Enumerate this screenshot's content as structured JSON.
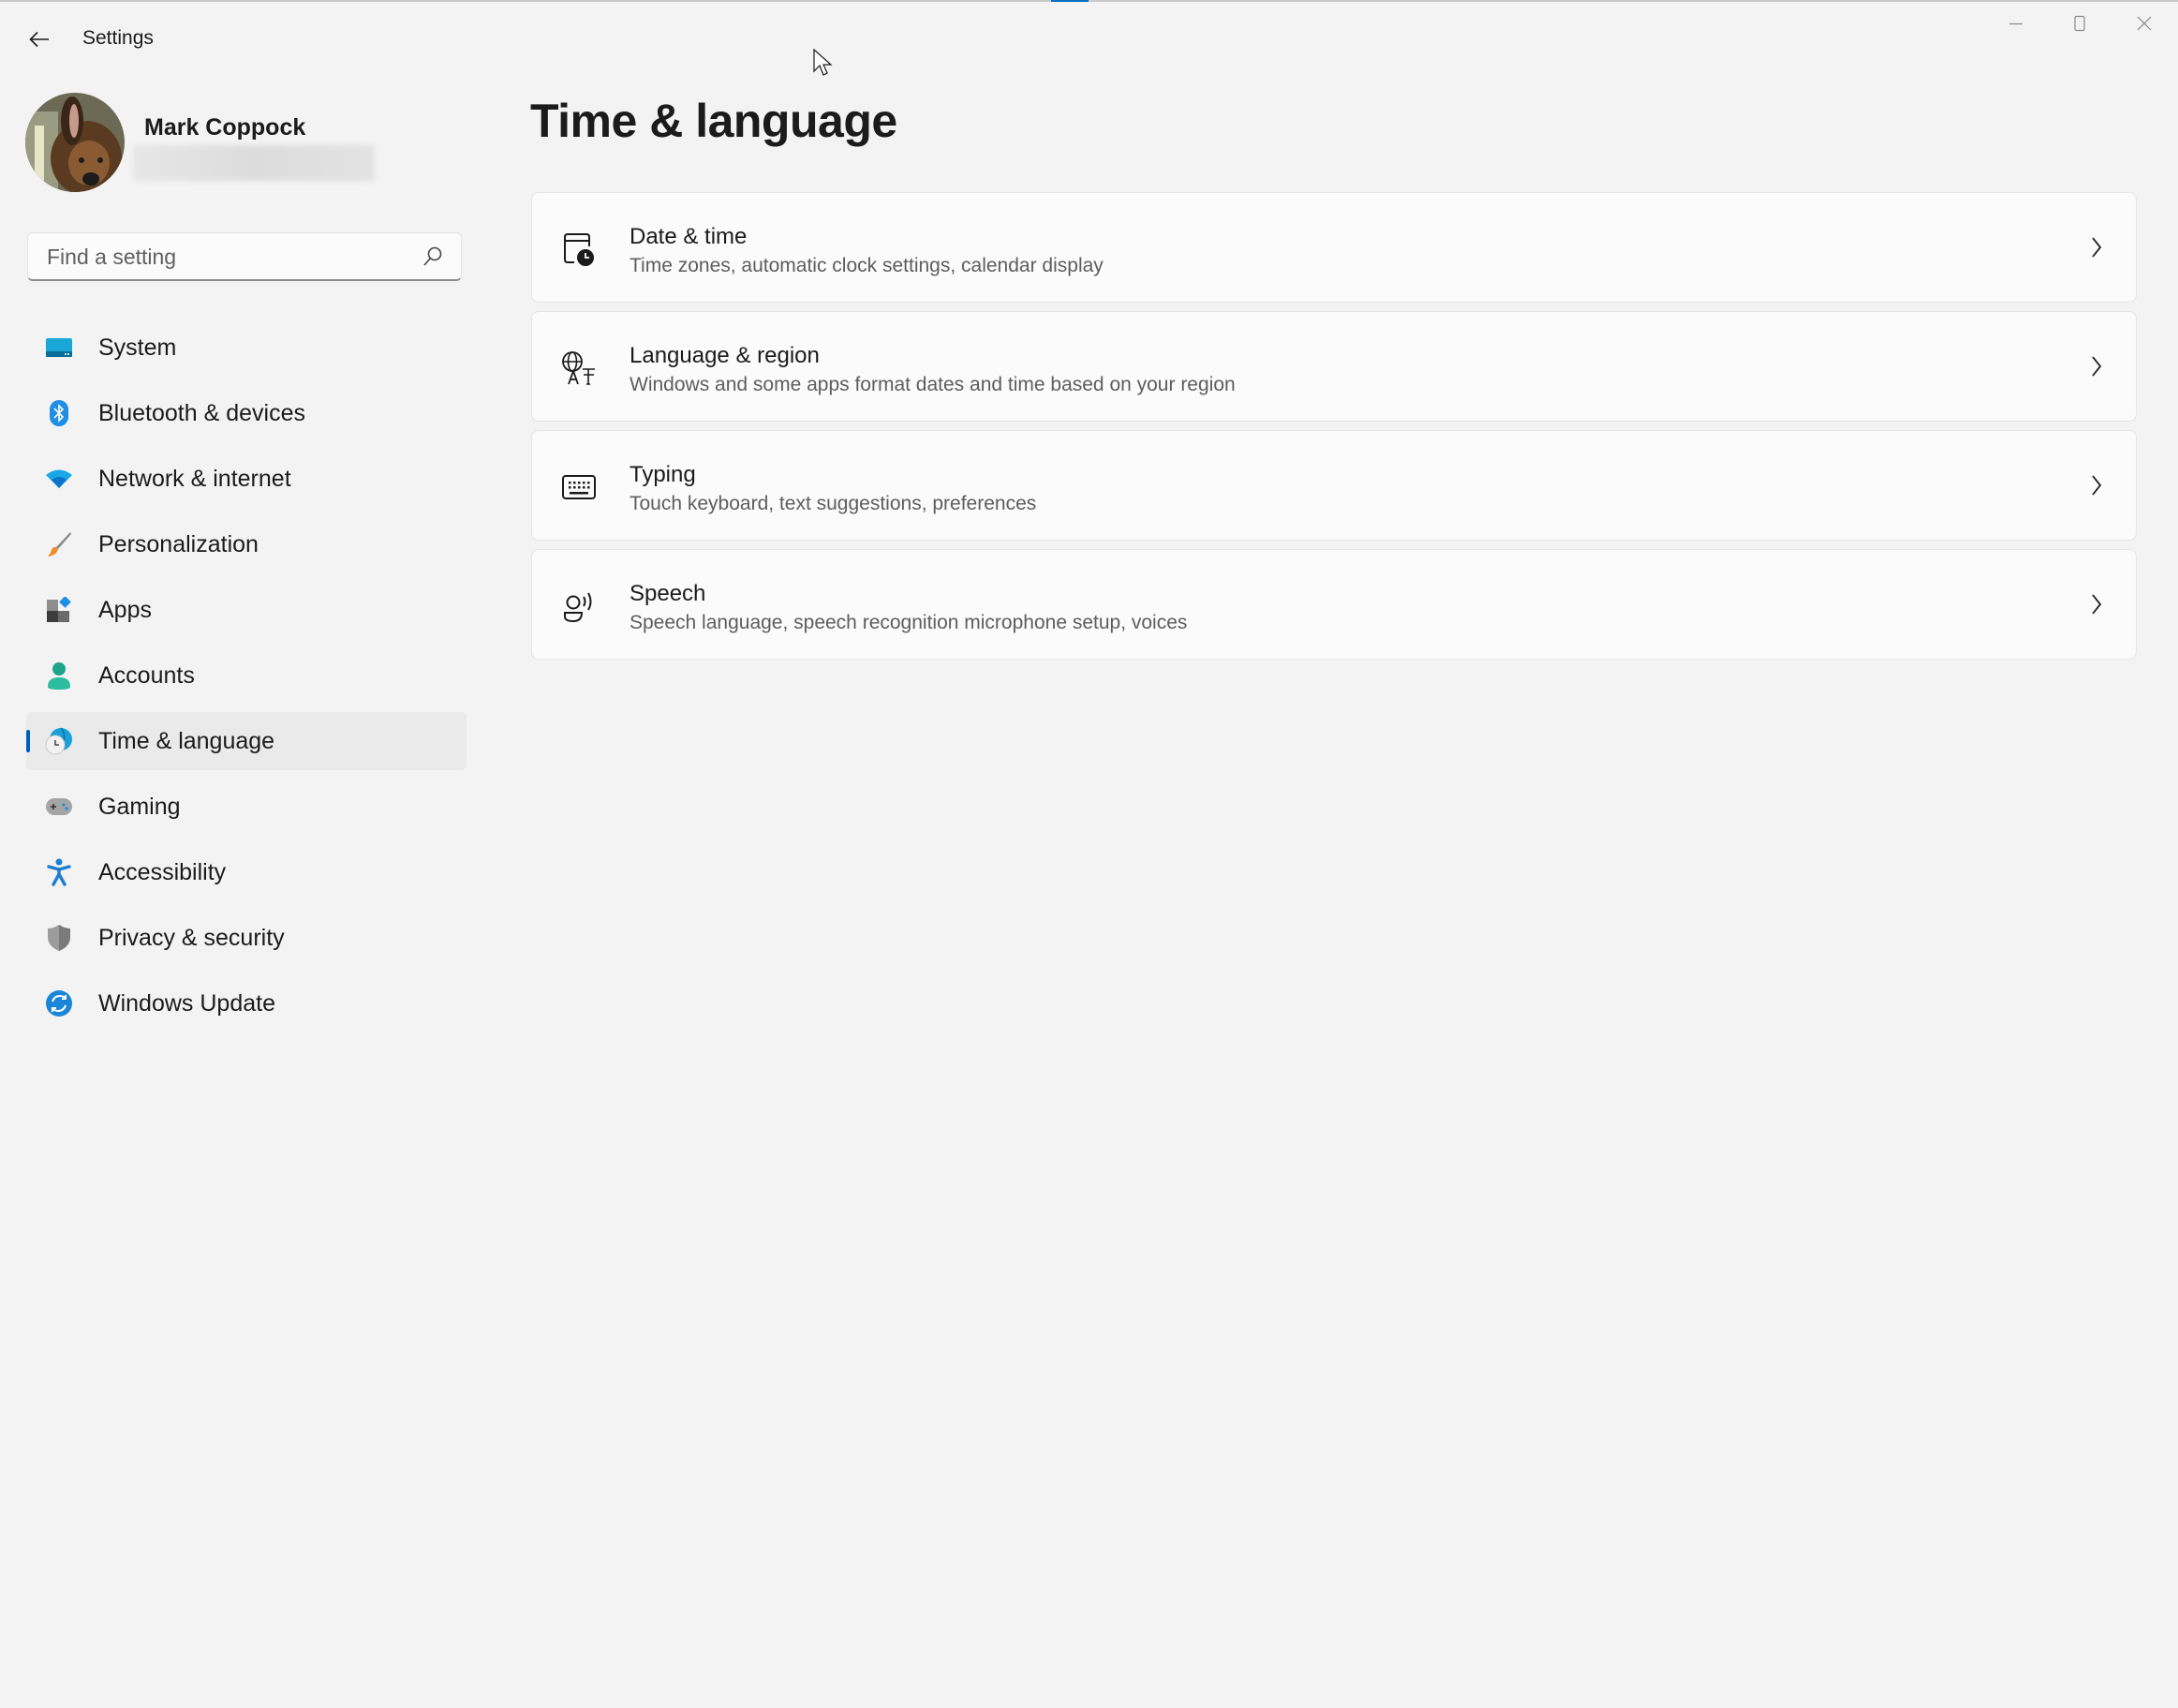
{
  "app": {
    "title": "Settings"
  },
  "window_controls": {
    "minimize": "minimize-icon",
    "maximize": "maximize-icon",
    "close": "close-icon"
  },
  "profile": {
    "name": "Mark Coppock",
    "email_redacted": true
  },
  "search": {
    "placeholder": "Find a setting",
    "value": ""
  },
  "sidebar": {
    "selected": "Time & language",
    "accent_color": "#005fb8",
    "items": [
      {
        "label": "System",
        "icon": "system-monitor-icon"
      },
      {
        "label": "Bluetooth & devices",
        "icon": "bluetooth-icon"
      },
      {
        "label": "Network & internet",
        "icon": "wifi-icon"
      },
      {
        "label": "Personalization",
        "icon": "paintbrush-icon"
      },
      {
        "label": "Apps",
        "icon": "apps-icon"
      },
      {
        "label": "Accounts",
        "icon": "person-icon"
      },
      {
        "label": "Time & language",
        "icon": "globe-clock-icon"
      },
      {
        "label": "Gaming",
        "icon": "gamepad-icon"
      },
      {
        "label": "Accessibility",
        "icon": "accessibility-icon"
      },
      {
        "label": "Privacy & security",
        "icon": "shield-icon"
      },
      {
        "label": "Windows Update",
        "icon": "update-icon"
      }
    ]
  },
  "main": {
    "title": "Time & language",
    "cards": [
      {
        "title": "Date & time",
        "description": "Time zones, automatic clock settings, calendar display",
        "icon": "calendar-clock-icon"
      },
      {
        "title": "Language & region",
        "description": "Windows and some apps format dates and time based on your region",
        "icon": "language-icon"
      },
      {
        "title": "Typing",
        "description": "Touch keyboard, text suggestions, preferences",
        "icon": "keyboard-icon"
      },
      {
        "title": "Speech",
        "description": "Speech language, speech recognition microphone setup, voices",
        "icon": "speech-icon"
      }
    ]
  }
}
